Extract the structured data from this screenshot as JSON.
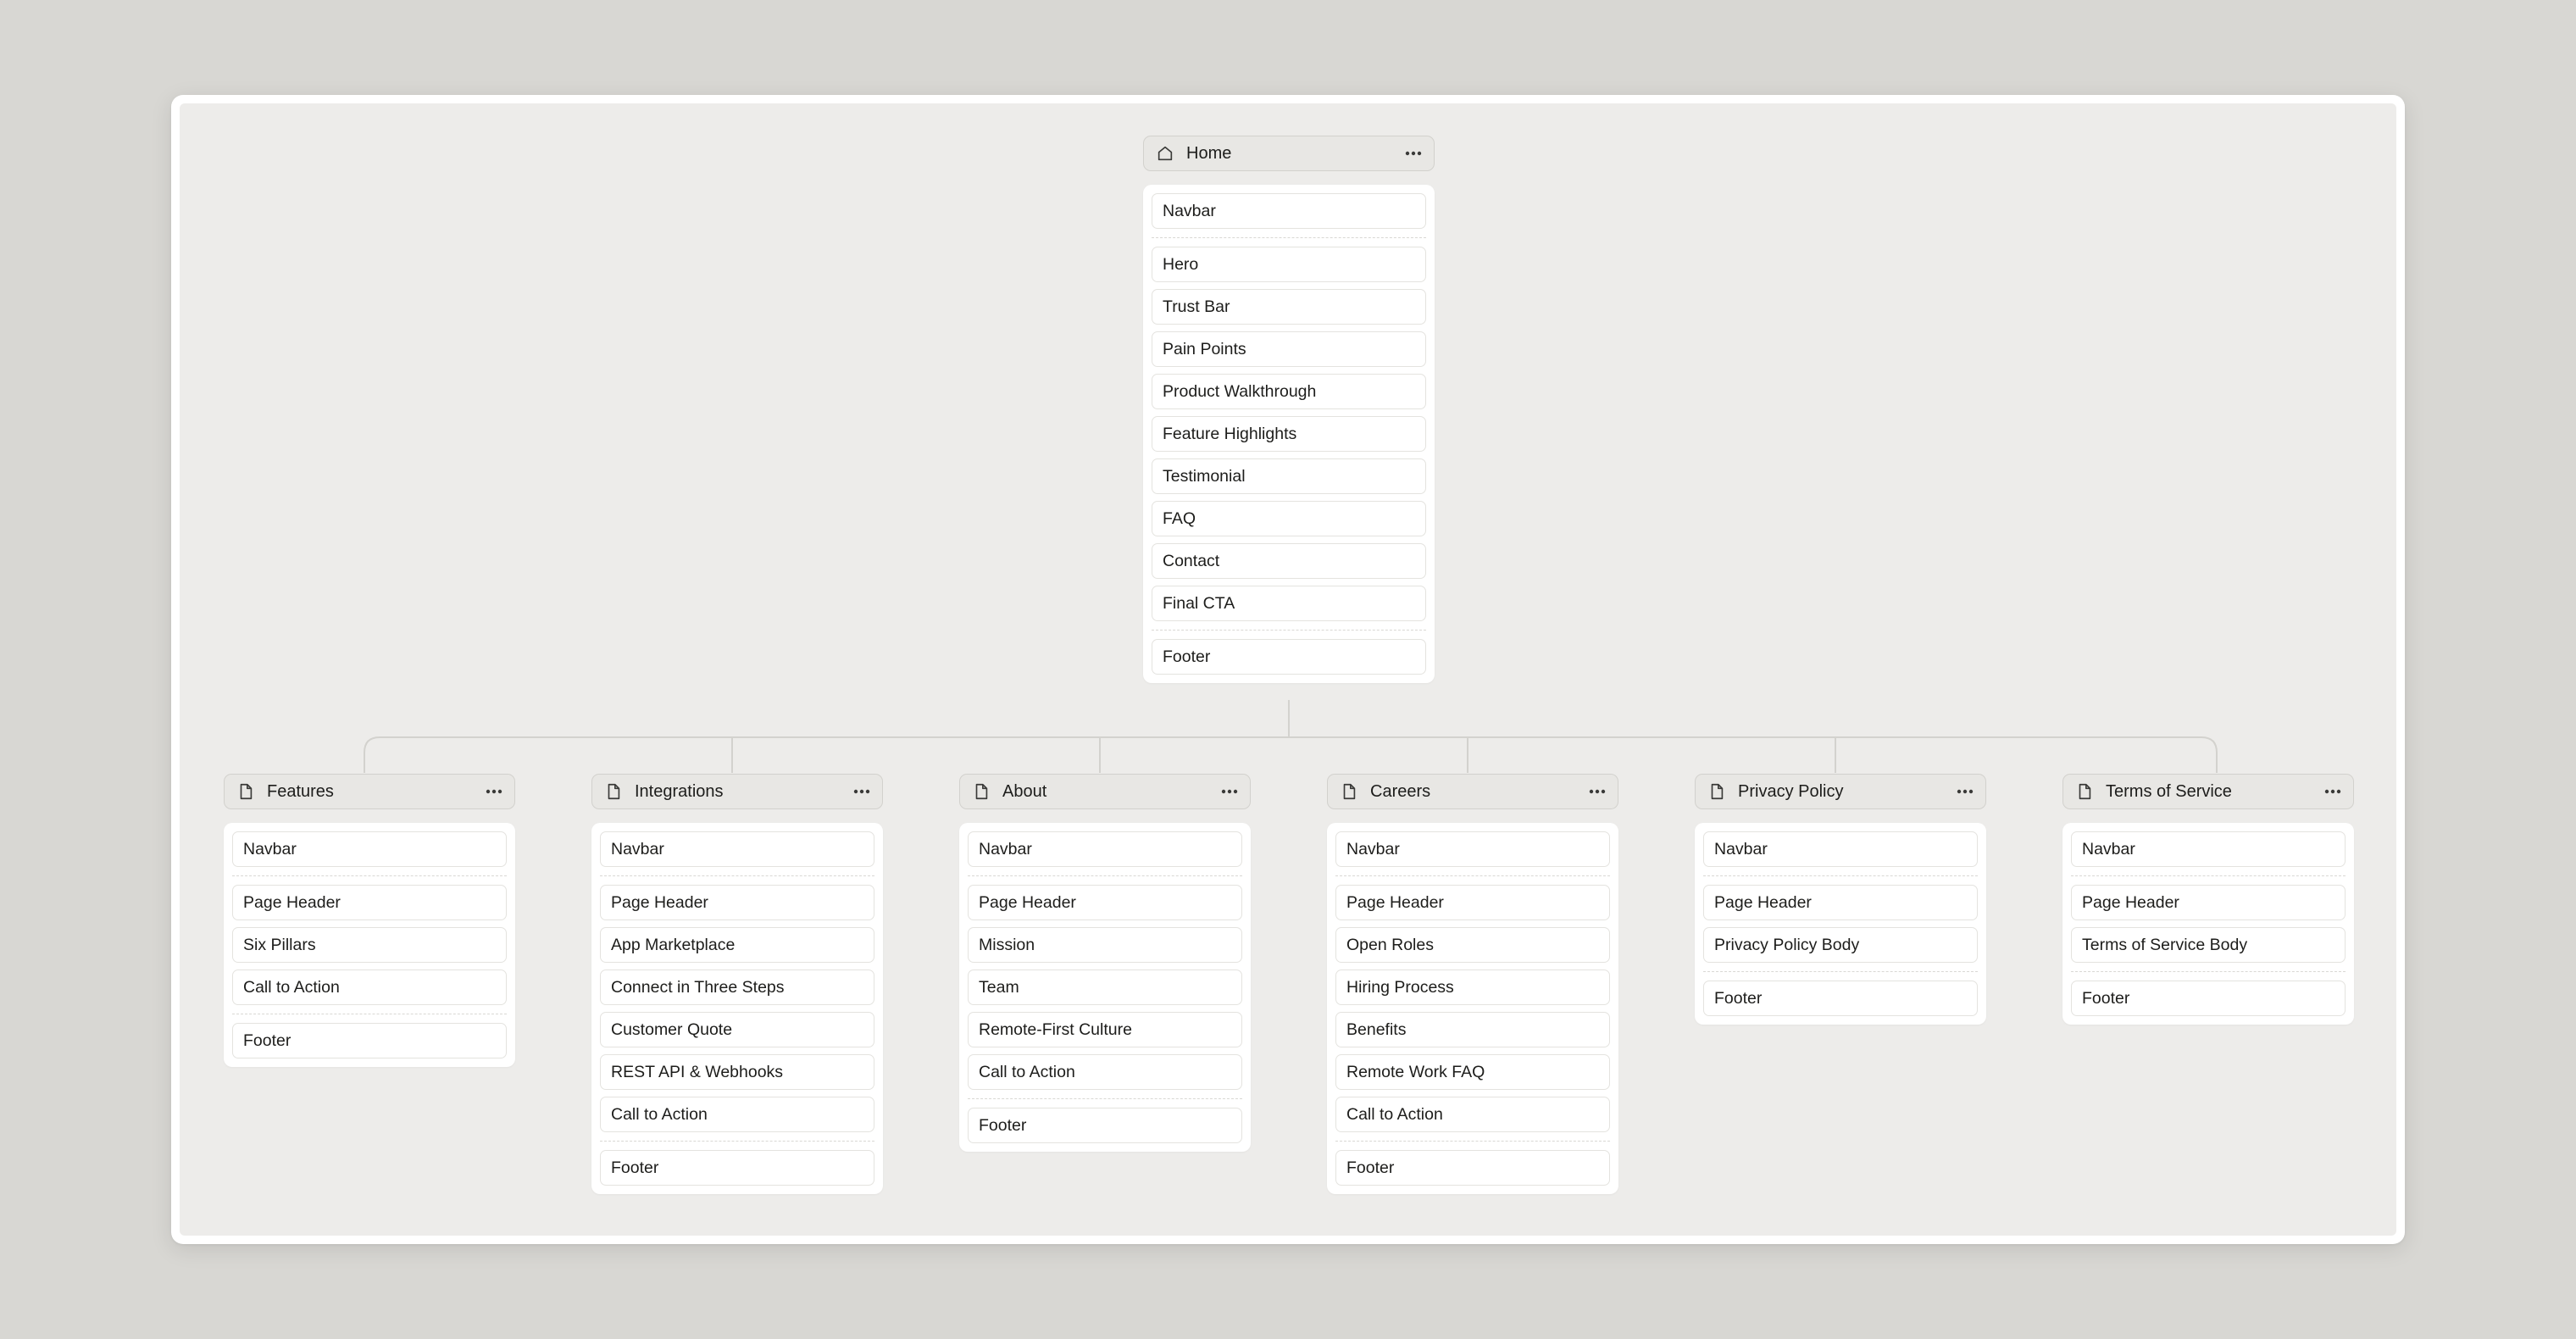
{
  "colors": {
    "background": "#d8d7d3",
    "canvas": "#edecea",
    "connector": "#d3d2ce",
    "text": "#1d1d1b"
  },
  "home": {
    "title": "Home",
    "icon": "home-icon",
    "more_icon": "ellipsis-icon",
    "navbar": "Navbar",
    "sections": [
      "Hero",
      "Trust Bar",
      "Pain Points",
      "Product Walkthrough",
      "Feature Highlights",
      "Testimonial",
      "FAQ",
      "Contact",
      "Final CTA"
    ],
    "footer": "Footer"
  },
  "pages": [
    {
      "title": "Features",
      "icon": "page-icon",
      "navbar": "Navbar",
      "sections": [
        "Page Header",
        "Six Pillars",
        "Call to Action"
      ],
      "footer": "Footer"
    },
    {
      "title": "Integrations",
      "icon": "page-icon",
      "navbar": "Navbar",
      "sections": [
        "Page Header",
        "App Marketplace",
        "Connect in Three Steps",
        "Customer Quote",
        "REST API & Webhooks",
        "Call to Action"
      ],
      "footer": "Footer"
    },
    {
      "title": "About",
      "icon": "page-icon",
      "navbar": "Navbar",
      "sections": [
        "Page Header",
        "Mission",
        "Team",
        "Remote-First Culture",
        "Call to Action"
      ],
      "footer": "Footer"
    },
    {
      "title": "Careers",
      "icon": "page-icon",
      "navbar": "Navbar",
      "sections": [
        "Page Header",
        "Open Roles",
        "Hiring Process",
        "Benefits",
        "Remote Work FAQ",
        "Call to Action"
      ],
      "footer": "Footer"
    },
    {
      "title": "Privacy Policy",
      "icon": "page-icon",
      "navbar": "Navbar",
      "sections": [
        "Page Header",
        "Privacy Policy Body"
      ],
      "footer": "Footer"
    },
    {
      "title": "Terms of Service",
      "icon": "page-icon",
      "navbar": "Navbar",
      "sections": [
        "Page Header",
        "Terms of Service Body"
      ],
      "footer": "Footer"
    }
  ]
}
